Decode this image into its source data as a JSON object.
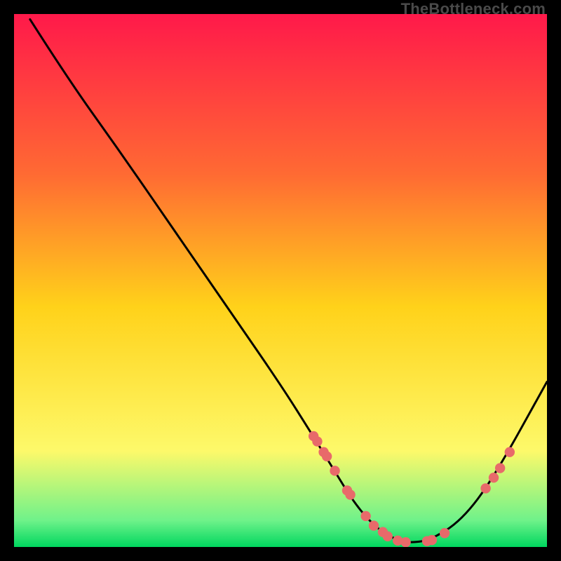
{
  "watermark": "TheBottleneck.com",
  "colors": {
    "frame": "#000000",
    "curve": "#000000",
    "marker_fill": "#e86a6a",
    "marker_stroke": "#c94f4f",
    "grad_top": "#ff194a",
    "grad_mid_upper": "#ff6a33",
    "grad_mid": "#ffd21a",
    "grad_lower": "#fdf96a",
    "grad_green_light": "#6ff28a",
    "grad_green": "#00d75f"
  },
  "chart_data": {
    "type": "line",
    "title": "",
    "xlabel": "",
    "ylabel": "",
    "xlim": [
      0,
      100
    ],
    "ylim": [
      0,
      100
    ],
    "grid": false,
    "legend": false,
    "series": [
      {
        "name": "curve",
        "x": [
          3,
          10,
          20,
          30,
          40,
          50,
          56,
          60,
          64,
          68,
          72,
          74,
          78,
          84,
          90,
          100
        ],
        "y": [
          99,
          88,
          74,
          59.5,
          45,
          30.5,
          21,
          14.5,
          8,
          3.5,
          1.2,
          0.8,
          1.2,
          5,
          13,
          31
        ]
      }
    ],
    "markers": {
      "name": "highlight-points",
      "x": [
        56.2,
        56.9,
        58.1,
        58.7,
        60.2,
        62.5,
        63.1,
        66.0,
        67.5,
        69.2,
        70.1,
        72.0,
        73.5,
        77.5,
        78.4,
        80.8,
        88.5,
        90.0,
        91.2,
        93.0
      ],
      "y": [
        20.8,
        19.8,
        17.8,
        17.0,
        14.3,
        10.6,
        9.8,
        5.8,
        4.0,
        2.8,
        2.0,
        1.2,
        0.9,
        1.1,
        1.3,
        2.6,
        11.0,
        13.0,
        14.8,
        17.8
      ]
    }
  }
}
